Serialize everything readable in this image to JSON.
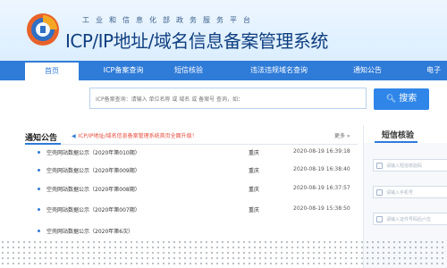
{
  "header": {
    "subtitle": "工业和信息化部政务服务平台",
    "title": "ICP/IP地址/域名信息备案管理系统"
  },
  "nav": [
    {
      "label": "首页",
      "active": true
    },
    {
      "label": "ICP备案查询",
      "active": false
    },
    {
      "label": "短信核验",
      "active": false
    },
    {
      "label": "违法违规域名查询",
      "active": false
    },
    {
      "label": "通知公告",
      "active": false
    },
    {
      "label": "电子",
      "active": false
    }
  ],
  "search": {
    "placeholder": "ICP备案查询：请输入 单位名称 或 域名 或 备案号 查询，如：",
    "button_label": "搜索"
  },
  "notices": {
    "heading": "通知公告",
    "scroll_text": "ICP/IP地址/域名信息备案管理系统首页全面升级！",
    "more": "更多 »",
    "items": [
      {
        "title": "空壳网站数据公示（2020年第010期）",
        "region": "重庆",
        "date": "2020-08-19 16:39:18"
      },
      {
        "title": "空壳网站数据公示（2020年第009期）",
        "region": "重庆",
        "date": "2020-08-19 16:38:40"
      },
      {
        "title": "空壳网站数据公示（2020年第008期）",
        "region": "重庆",
        "date": "2020-08-19 16:37:57"
      },
      {
        "title": "空壳网站数据公示（2020年第007期）",
        "region": "重庆",
        "date": "2020-08-19 15:38:50"
      },
      {
        "title": "空壳网站数据公示（2020年第6次）",
        "region": "",
        "date": ""
      }
    ]
  },
  "sms": {
    "title": "短信核验",
    "fields": [
      {
        "placeholder": "请输入短信核验码"
      },
      {
        "placeholder": "请输入手机号"
      },
      {
        "placeholder": "请输入证件号码后六位"
      }
    ]
  },
  "colors": {
    "nav_blue": "#2f7bd8",
    "title_blue": "#0f3f80",
    "notice_red": "#e64a3b"
  }
}
